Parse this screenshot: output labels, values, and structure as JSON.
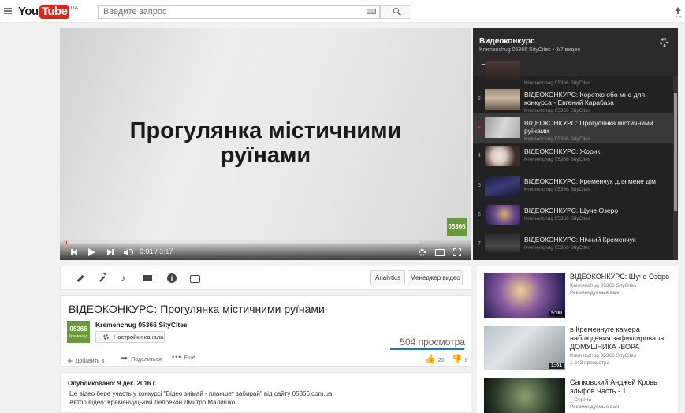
{
  "header": {
    "logo_you": "You",
    "logo_tube": "Tube",
    "logo_region": "UA",
    "search_placeholder": "Введите запрос"
  },
  "player": {
    "overlay_title_line1": "Прогулянка містичними",
    "overlay_title_line2": "руїнами",
    "watermark": "05366",
    "time_elapsed": "0:01",
    "time_separator": " / ",
    "time_duration": "3:17",
    "progress": 0.003
  },
  "playlist": {
    "title": "Видеоконкурс",
    "subtitle": "Kremenchug 05366 SityCites • 3/7 видео",
    "items": [
      {
        "index": "",
        "title": "",
        "channel": "Kremenchug 05366 SityCites",
        "active": false
      },
      {
        "index": "2",
        "title": "ВІДЕОКОНКУРС: Коротко обо мне для конкурса - Евгений Карабаза",
        "channel": "Kremenchug 05366 SityCites",
        "active": false
      },
      {
        "index": "▶",
        "title": "ВІДЕОКОНКУРС: Прогулянка містичними руїнами",
        "channel": "Kremenchug 05366 SityCites",
        "active": true
      },
      {
        "index": "4",
        "title": "ВІДЕОКОНКУРС: Жорик",
        "channel": "Kremenchug 05366 SityCites",
        "active": false
      },
      {
        "index": "5",
        "title": "ВІДЕОКОНКУРС: Кременчук для мене дім",
        "channel": "Kremenchug 05366 SityCites",
        "active": false
      },
      {
        "index": "6",
        "title": "ВІДЕОКОНКУРС: Щуче Озеро",
        "channel": "Kremenchug 05366 SityCites",
        "active": false
      },
      {
        "index": "7",
        "title": "ВІДЕОКОНКУРС: Нічний Кременчук",
        "channel": "Kremenchug 05366 SityCites",
        "active": false
      }
    ]
  },
  "actions": {
    "analytics": "Analytics",
    "manager": "Менеджер видео"
  },
  "video": {
    "title": "ВІДЕОКОНКУРС: Прогулянка містичними руїнами",
    "channel": "Kremenchug 05366 SityCites",
    "avatar_top": "05366",
    "avatar_bottom": "Кременчуг",
    "channel_settings": "Настройки канала",
    "views": "504 просмотра",
    "add_to": "Добавить в",
    "share": "Поделиться",
    "more": "Ещё",
    "likes": "20",
    "dislikes": "0"
  },
  "description": {
    "published": "Опубликовано: 9 дек. 2016 г.",
    "line1": "Це відео бере участь у конкурсі \"Відео знімай - планшет забирай\" від сайту 05366.com.ua",
    "line2": "Автор відео: Кременчуцький Лепрекон Дмитро Малишко"
  },
  "related": [
    {
      "title": "ВІДЕОКОНКУРС: Щуче Озеро",
      "meta1": "Kremenchug 05366 SityCites",
      "meta2": "Рекомендуемые вам",
      "duration": "5:00"
    },
    {
      "title": "в Кременчуге камера наблюдения зафиксировала ДОМУШНИКА -ВОРА",
      "meta1": "Kremenchug 05366 SityCites",
      "meta2": "1 243 просмотра",
      "duration": "1:01"
    },
    {
      "title": "Сапковский Анджей Кровь эльфов Часть - 1",
      "meta1": "_ Сергий",
      "meta2": "Рекомендуемые вам",
      "duration": ""
    }
  ],
  "colors": {
    "brand_red": "#e62117",
    "channel_green": "#6a9a3a",
    "link_blue": "#167ac6"
  }
}
